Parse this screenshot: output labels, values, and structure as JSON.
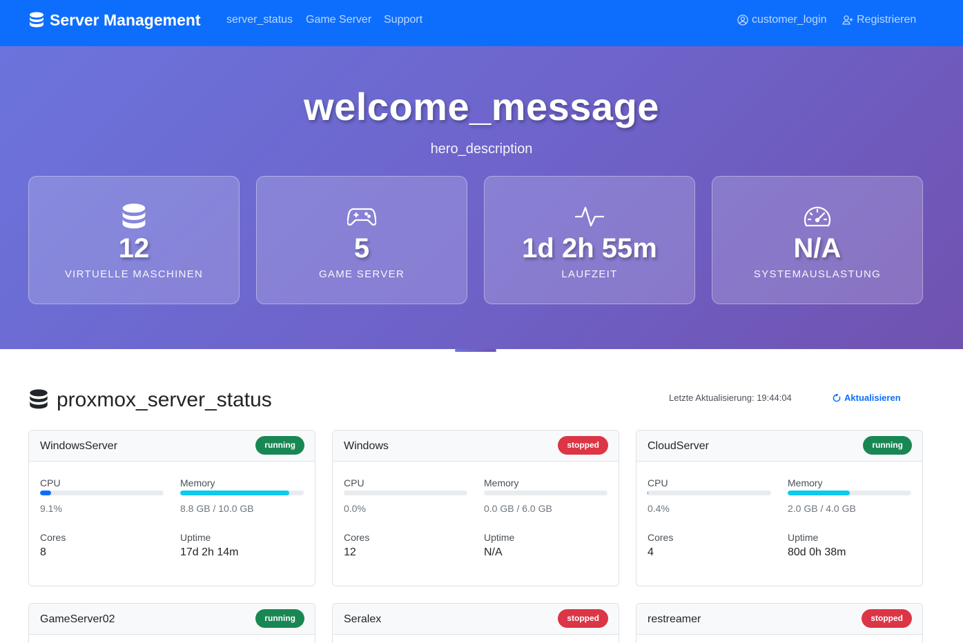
{
  "navbar": {
    "brand": "Server Management",
    "links": [
      "server_status",
      "Game Server",
      "Support"
    ],
    "login": "customer_login",
    "register": "Registrieren"
  },
  "hero": {
    "title": "welcome_message",
    "description": "hero_description",
    "stats": [
      {
        "icon": "database-icon",
        "value": "12",
        "label": "VIRTUELLE MASCHINEN"
      },
      {
        "icon": "gamepad-icon",
        "value": "5",
        "label": "GAME SERVER"
      },
      {
        "icon": "activity-icon",
        "value": "1d 2h 55m",
        "label": "LAUFZEIT"
      },
      {
        "icon": "speedometer-icon",
        "value": "N/A",
        "label": "SYSTEMAUSLASTUNG"
      }
    ]
  },
  "status_section": {
    "title": "proxmox_server_status",
    "last_update": "Letzte Aktualisierung: 19:44:04",
    "refresh_label": "Aktualisieren"
  },
  "labels": {
    "cpu": "CPU",
    "memory": "Memory",
    "cores": "Cores",
    "uptime": "Uptime"
  },
  "servers": [
    {
      "name": "WindowsServer",
      "status": "running",
      "cpu_text": "9.1%",
      "cpu_fraction": 0.091,
      "memory_text": "8.8 GB / 10.0 GB",
      "memory_fraction": 0.88,
      "cores": "8",
      "uptime": "17d 2h 14m"
    },
    {
      "name": "Windows",
      "status": "stopped",
      "cpu_text": "0.0%",
      "cpu_fraction": 0.0,
      "memory_text": "0.0 GB / 6.0 GB",
      "memory_fraction": 0.0,
      "cores": "12",
      "uptime": "N/A"
    },
    {
      "name": "CloudServer",
      "status": "running",
      "cpu_text": "0.4%",
      "cpu_fraction": 0.004,
      "memory_text": "2.0 GB / 4.0 GB",
      "memory_fraction": 0.5,
      "cores": "4",
      "uptime": "80d 0h 38m"
    },
    {
      "name": "GameServer02",
      "status": "running"
    },
    {
      "name": "Seralex",
      "status": "stopped"
    },
    {
      "name": "restreamer",
      "status": "stopped"
    }
  ],
  "colors": {
    "navbar": "#0d6efd",
    "running": "#198754",
    "stopped": "#dc3545",
    "cpu_bar": "#0d6efd",
    "memory_bar": "#0dcaf0"
  }
}
